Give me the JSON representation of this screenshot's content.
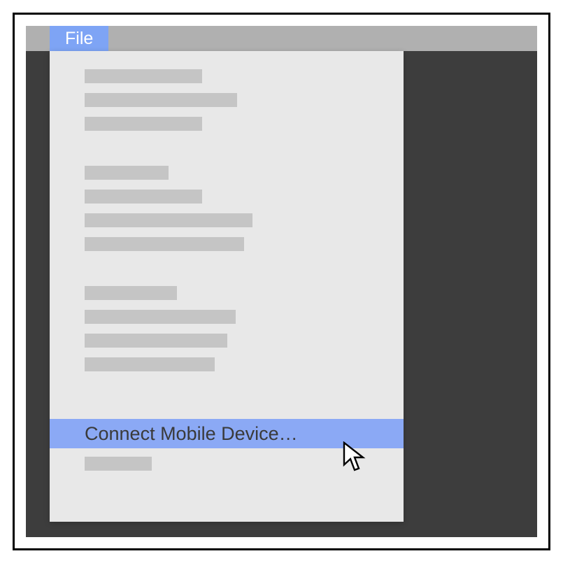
{
  "menubar": {
    "file_label": "File"
  },
  "file_menu": {
    "highlighted_item": "Connect Mobile Device…"
  },
  "colors": {
    "accent": "#7ea4f5",
    "highlight": "#8ba9f5",
    "menubar": "#b0b0b0",
    "dropdown_bg": "#e8e8e8",
    "placeholder": "#c5c5c5",
    "shell_bg": "#3d3d3d"
  }
}
